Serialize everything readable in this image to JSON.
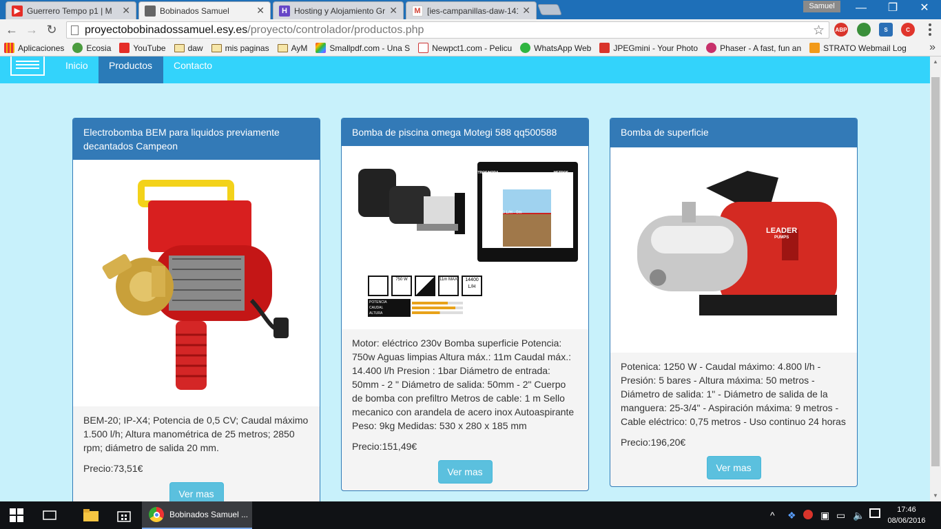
{
  "browser": {
    "tabs": [
      {
        "title": "Guerrero Tempo p1 | M",
        "icon": "youtube-icon"
      },
      {
        "title": "Bobinados Samuel",
        "icon": "page-icon",
        "active": true
      },
      {
        "title": "Hosting y Alojamiento Gra",
        "icon": "hostinger-icon"
      },
      {
        "title": "[ies-campanillas-daw-141(",
        "icon": "gmail-icon"
      }
    ],
    "profile": "Samuel",
    "url_host": "proyectobobinadossamuel.esy.es",
    "url_path": "/proyecto/controlador/productos.php",
    "bookmarks": [
      {
        "label": "Aplicaciones",
        "icon": "apps-grid-icon"
      },
      {
        "label": "Ecosia",
        "icon": "ecosia-icon"
      },
      {
        "label": "YouTube",
        "icon": "youtube-icon"
      },
      {
        "label": "daw",
        "icon": "folder-icon"
      },
      {
        "label": "mis paginas",
        "icon": "folder-icon"
      },
      {
        "label": "AyM",
        "icon": "folder-icon"
      },
      {
        "label": "Smallpdf.com - Una S",
        "icon": "smallpdf-icon"
      },
      {
        "label": "Newpct1.com - Pelicu",
        "icon": "newpct-icon"
      },
      {
        "label": "WhatsApp Web",
        "icon": "whatsapp-icon"
      },
      {
        "label": "JPEGmini - Your Photo",
        "icon": "jpegmini-icon"
      },
      {
        "label": "Phaser - A fast, fun an",
        "icon": "phaser-icon"
      },
      {
        "label": "STRATO Webmail Log",
        "icon": "strato-icon"
      }
    ],
    "extensions": [
      "ABP"
    ]
  },
  "site": {
    "nav": [
      {
        "label": "Inicio"
      },
      {
        "label": "Productos",
        "active": true
      },
      {
        "label": "Contacto"
      }
    ]
  },
  "products": [
    {
      "title": "Electrobomba BEM para liquidos previamente decantados Campeon",
      "description": "BEM-20; IP-X4; Potencia de 0,5 CV; Caudal máximo 1.500 l/h; Altura manométrica de 25 metros; 2850 rpm; diámetro de salida 20 mm.",
      "price": "Precio:73,51€",
      "button": "Ver mas"
    },
    {
      "title": "Bomba de piscina omega Motegi 588 qq500588",
      "description": "Motor: eléctrico 230v Bomba superficie Potencia: 750w Aguas limpias Altura máx.: 11m Caudal máx.: 14.400 l/h Presion : 1bar Diámetro de entrada: 50mm - 2 \" Diámetro de salida: 50mm - 2\" Cuerpo de bomba con prefiltro Metros de cable: 1 m Sello mecanico con arandela de acero inox Autoaspirante Peso: 9kg Medidas: 530 x 280 x 185 mm",
      "price": "Precio:151,49€",
      "button": "Ver mas",
      "image_text": {
        "header_left": "LITROS/HORA",
        "header_right": "METROS",
        "flow": "14.400 L/H - 0m",
        "watt": "750 W",
        "depth": "11m MAX",
        "liters": "14400 L/H",
        "legend": [
          "POTENCIA",
          "CAUDAL",
          "ALTURA"
        ]
      }
    },
    {
      "title": "Bomba de superficie",
      "description": "Potenica: 1250 W - Caudal máximo: 4.800 l/h - Presión: 5 bares - Altura máxima: 50 metros - Diámetro de salida: 1\" - Diámetro de salida de la manguera: 25-3/4\" - Aspiración máxima: 9 metros - Cable eléctrico: 0,75 metros - Uso continuo 24 horas",
      "price": "Precio:196,20€",
      "button": "Ver mas",
      "image_text": {
        "brand": "LEADER",
        "sub": "PUMPS"
      }
    }
  ],
  "taskbar": {
    "app_label": "Bobinados Samuel ...",
    "time": "17:46",
    "date": "08/06/2016"
  }
}
